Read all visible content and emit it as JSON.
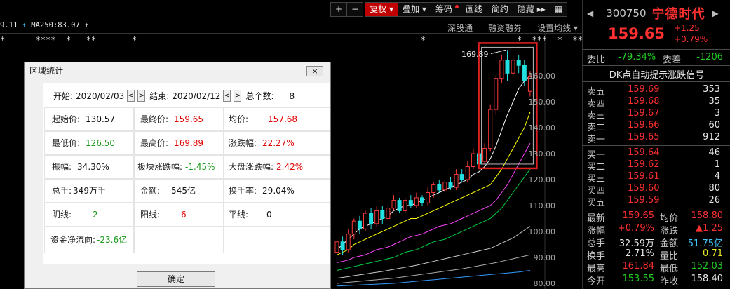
{
  "toolbar": {
    "plus": "+",
    "minus": "−",
    "buttons": [
      "复权",
      "叠加",
      "筹码",
      "画线",
      "简约",
      "隐藏"
    ],
    "more": "▸▸",
    "dropdown_arrow": "▾",
    "menu_tab": "▦"
  },
  "ma_line": {
    "prefix": "9.11",
    "ma250": "MA250:83.07"
  },
  "subtabs": [
    "深股通",
    "融资融券",
    "设置均线 ▾"
  ],
  "stars": "*      ****  *   **       *                                                        *                  *  ***  *  ** *      **         *",
  "chart_data": {
    "type": "candlestick",
    "y_ticks": [
      "160.00",
      "150.00",
      "140.00",
      "130.00",
      "120.00",
      "110.00",
      "100.00",
      "90.00",
      "80.00"
    ],
    "high_label": "169.89",
    "candles": [
      {
        "o": 92,
        "c": 96,
        "h": 98,
        "l": 91
      },
      {
        "o": 96,
        "c": 93,
        "h": 98,
        "l": 91
      },
      {
        "o": 93,
        "c": 99,
        "h": 101,
        "l": 92
      },
      {
        "o": 99,
        "c": 104,
        "h": 105,
        "l": 97
      },
      {
        "o": 104,
        "c": 101,
        "h": 106,
        "l": 99
      },
      {
        "o": 101,
        "c": 107,
        "h": 108,
        "l": 100
      },
      {
        "o": 107,
        "c": 103,
        "h": 109,
        "l": 101
      },
      {
        "o": 103,
        "c": 108,
        "h": 110,
        "l": 102
      },
      {
        "o": 108,
        "c": 105,
        "h": 110,
        "l": 103
      },
      {
        "o": 105,
        "c": 109,
        "h": 111,
        "l": 104
      },
      {
        "o": 109,
        "c": 112,
        "h": 114,
        "l": 108
      },
      {
        "o": 112,
        "c": 108,
        "h": 113,
        "l": 107
      },
      {
        "o": 108,
        "c": 112,
        "h": 113,
        "l": 107
      },
      {
        "o": 112,
        "c": 110,
        "h": 114,
        "l": 109
      },
      {
        "o": 110,
        "c": 113,
        "h": 115,
        "l": 109
      },
      {
        "o": 113,
        "c": 111,
        "h": 114,
        "l": 110
      },
      {
        "o": 111,
        "c": 115,
        "h": 117,
        "l": 110
      },
      {
        "o": 115,
        "c": 118,
        "h": 119,
        "l": 113
      },
      {
        "o": 118,
        "c": 116,
        "h": 120,
        "l": 115
      },
      {
        "o": 116,
        "c": 119,
        "h": 120,
        "l": 115
      },
      {
        "o": 119,
        "c": 117,
        "h": 121,
        "l": 116
      },
      {
        "o": 117,
        "c": 122,
        "h": 124,
        "l": 116
      },
      {
        "o": 122,
        "c": 120,
        "h": 124,
        "l": 119
      },
      {
        "o": 120,
        "c": 125,
        "h": 127,
        "l": 119
      },
      {
        "o": 125,
        "c": 130,
        "h": 132,
        "l": 124
      },
      {
        "o": 130,
        "c": 126,
        "h": 131,
        "l": 125
      },
      {
        "o": 127,
        "c": 132,
        "h": 134,
        "l": 126
      },
      {
        "o": 132,
        "c": 147,
        "h": 149,
        "l": 131
      },
      {
        "o": 147,
        "c": 159,
        "h": 160,
        "l": 145
      },
      {
        "o": 159,
        "c": 166,
        "h": 168,
        "l": 157
      },
      {
        "o": 166,
        "c": 161,
        "h": 169.89,
        "l": 158
      },
      {
        "o": 161,
        "c": 166,
        "h": 168,
        "l": 160
      },
      {
        "o": 166,
        "c": 164,
        "h": 168,
        "l": 161
      },
      {
        "o": 164,
        "c": 158,
        "h": 166,
        "l": 156
      },
      {
        "o": 154,
        "c": 159.65,
        "h": 161.84,
        "l": 152.03
      }
    ],
    "ma_lines": [
      {
        "color": "#ffffff",
        "values": [
          93,
          95,
          97,
          99,
          101,
          102,
          103,
          104,
          105,
          106,
          108,
          109,
          110,
          110,
          111,
          112,
          113,
          114,
          115,
          116,
          117,
          118,
          119,
          120,
          122,
          123,
          125,
          128,
          133,
          139,
          145,
          150,
          155,
          158,
          160
        ]
      },
      {
        "color": "#ffff00",
        "values": [
          91,
          92,
          93,
          95,
          96,
          97,
          98,
          99,
          100,
          101,
          102,
          103,
          104,
          105,
          105,
          106,
          107,
          108,
          109,
          110,
          111,
          112,
          113,
          114,
          115,
          116,
          117,
          118,
          121,
          124,
          128,
          132,
          136,
          140,
          146
        ]
      },
      {
        "color": "#ff44ff",
        "values": [
          88,
          88.5,
          89,
          90,
          90.5,
          91,
          92,
          93,
          93.5,
          94,
          95,
          96,
          97,
          98,
          98.5,
          99,
          100,
          101,
          102,
          102.5,
          103,
          104,
          105,
          106,
          107,
          108,
          109,
          110,
          112,
          115,
          118,
          122,
          126,
          130,
          134
        ]
      },
      {
        "color": "#00cc44",
        "values": [
          85,
          85.5,
          86,
          86.5,
          87,
          87.5,
          88,
          88.5,
          89,
          89.5,
          90,
          91,
          92,
          92.5,
          93,
          94,
          95,
          96,
          96.5,
          97,
          98,
          99,
          100,
          101,
          102,
          103,
          104,
          105,
          107,
          109,
          112,
          115,
          118,
          121,
          124
        ]
      },
      {
        "color": "#c8c8c8",
        "values": [
          82,
          82.3,
          82.6,
          83,
          83.3,
          83.6,
          84,
          84.3,
          84.6,
          85,
          85.4,
          85.8,
          86.2,
          86.6,
          87,
          87.5,
          88,
          88.5,
          89,
          89.5,
          90,
          90.5,
          91,
          91.5,
          92,
          92.5,
          93,
          93.5,
          94.5,
          95.5,
          96.5,
          97.5,
          99,
          100.5,
          102
        ]
      },
      {
        "color": "#aaaaaa",
        "values": [
          80,
          80.2,
          80.4,
          80.6,
          80.8,
          81,
          81.2,
          81.4,
          81.6,
          81.8,
          82,
          82.3,
          82.6,
          82.9,
          83.2,
          83.5,
          83.8,
          84.1,
          84.4,
          84.7,
          85,
          85.3,
          85.6,
          86,
          86.4,
          86.8,
          87.2,
          87.6,
          88,
          88.5,
          89,
          89.5,
          90,
          90.5,
          91
        ]
      },
      {
        "color": "#3399ff",
        "values": [
          79,
          79.1,
          79.2,
          79.3,
          79.4,
          79.5,
          79.6,
          79.7,
          79.8,
          79.9,
          80,
          80.2,
          80.4,
          80.6,
          80.8,
          81,
          81.2,
          81.4,
          81.6,
          81.8,
          82,
          82.2,
          82.4,
          82.6,
          82.8,
          83,
          83.2,
          83.4,
          83.6,
          83.8,
          84,
          84.2,
          84.4,
          84.7,
          85
        ]
      }
    ]
  },
  "dialog": {
    "title": "区域统计",
    "close": "×",
    "start_label": "开始:",
    "start_date": "2020/02/03",
    "end_label": "结束:",
    "end_date": "2020/02/12",
    "total_label": "总个数:",
    "total_value": "8",
    "prev": "<",
    "next": ">",
    "cells": {
      "open_label": "起始价:",
      "open_value": "130.57",
      "close_label": "最终价:",
      "close_value": "159.65",
      "avg_label": "均价:",
      "avg_value": "157.68",
      "low_label": "最低价:",
      "low_value": "126.50",
      "high_label": "最高价:",
      "high_value": "169.89",
      "chg_label": "涨跌幅:",
      "chg_value": "22.27%",
      "amp_label": "振幅:",
      "amp_value": "34.30%",
      "sector_label": "板块涨跌幅:",
      "sector_value": "-1.45%",
      "market_label": "大盘涨跌幅:",
      "market_value": "2.42%",
      "vol_label": "总手:",
      "vol_value": "349万手",
      "amt_label": "金额:",
      "amt_value": "545亿",
      "turn_label": "换手率:",
      "turn_value": "29.04%",
      "neg_label": "阴线:",
      "neg_value": "2",
      "pos_label": "阳线:",
      "pos_value": "6",
      "flat_label": "平线:",
      "flat_value": "0",
      "flow_label": "资金净流向:",
      "flow_value": "-23.6亿"
    },
    "ok": "确定"
  },
  "quote": {
    "left_arrow": "◀",
    "right_arrow": "▶",
    "code": "300750",
    "name": "宁德时代",
    "price": "159.65",
    "change": "+1.25",
    "change_pct": "+0.79%",
    "wb_label": "委比",
    "wb_value": "-79.34%",
    "wc_label": "委差",
    "wc_value": "-1206",
    "signal": "DK点自动提示涨跌信号",
    "asks": [
      {
        "label": "卖五",
        "price": "159.69",
        "vol": "353"
      },
      {
        "label": "卖四",
        "price": "159.68",
        "vol": "35"
      },
      {
        "label": "卖三",
        "price": "159.67",
        "vol": "3"
      },
      {
        "label": "卖二",
        "price": "159.66",
        "vol": "60"
      },
      {
        "label": "卖一",
        "price": "159.65",
        "vol": "912"
      }
    ],
    "bids": [
      {
        "label": "买一",
        "price": "159.64",
        "vol": "46"
      },
      {
        "label": "买二",
        "price": "159.62",
        "vol": "1"
      },
      {
        "label": "买三",
        "price": "159.61",
        "vol": "4"
      },
      {
        "label": "买四",
        "price": "159.60",
        "vol": "80"
      },
      {
        "label": "买五",
        "price": "159.59",
        "vol": "26"
      }
    ],
    "stats": [
      {
        "k1": "最新",
        "v1": "159.65",
        "c1": "#ff3030",
        "k2": "均价",
        "v2": "158.80",
        "c2": "#ff3030"
      },
      {
        "k1": "涨幅",
        "v1": "+0.79%",
        "c1": "#ff3030",
        "k2": "涨跌",
        "v2": "▲1.25",
        "c2": "#ff3030"
      },
      {
        "k1": "总手",
        "v1": "32.59万",
        "c1": "#e8e8e8",
        "k2": "金额",
        "v2": "51.75亿",
        "c2": "#44c8ff"
      },
      {
        "k1": "换手",
        "v1": "2.71%",
        "c1": "#e8e8e8",
        "k2": "量比",
        "v2": "0.71",
        "c2": "#e8e822"
      },
      {
        "k1": "最高",
        "v1": "161.84",
        "c1": "#ff3030",
        "k2": "最低",
        "v2": "152.03",
        "c2": "#22cc22"
      },
      {
        "k1": "今开",
        "v1": "153.55",
        "c1": "#22cc22",
        "k2": "昨收",
        "v2": "158.40",
        "c2": "#e8e8e8"
      }
    ]
  }
}
